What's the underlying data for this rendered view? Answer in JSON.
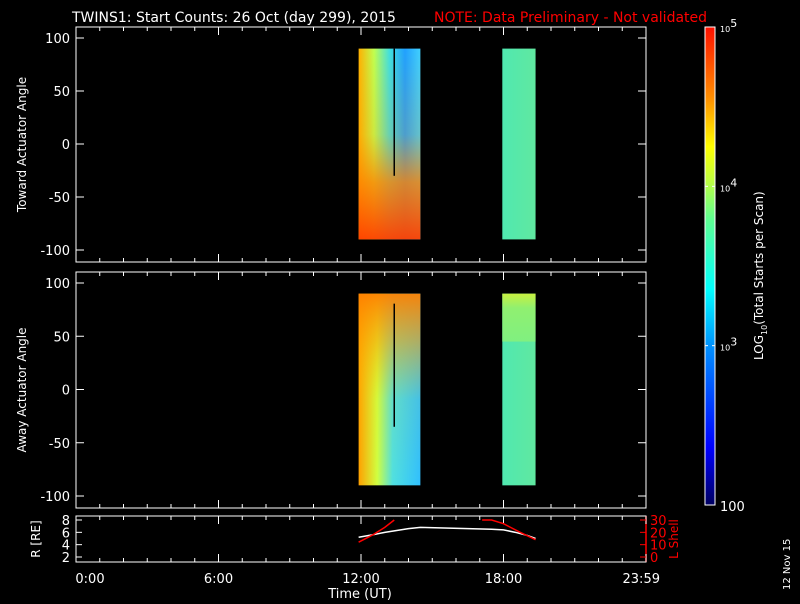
{
  "title": "TWINS1: Start Counts: 26 Oct (day 299), 2015",
  "note": "NOTE: Data Preliminary - Not validated",
  "date_stamp": "12 Nov 15",
  "colors": {
    "note": "#ff0000",
    "lshell": "#ff0000",
    "axis": "#ffffff"
  },
  "chart_data": [
    {
      "type": "heatmap",
      "ylabel": "Toward Actuator Angle",
      "ylim": [
        -100,
        100
      ],
      "yticks": [
        "100",
        "50",
        "0",
        "-50",
        "-100"
      ],
      "ytick_values": [
        100,
        50,
        0,
        -50,
        -100
      ],
      "xlim_hours": [
        0,
        24
      ],
      "data_blocks_hours": [
        [
          11.9,
          14.5
        ],
        [
          17.95,
          19.35
        ]
      ],
      "angle_range": [
        -90,
        90
      ]
    },
    {
      "type": "heatmap",
      "ylabel": "Away Actuator Angle",
      "ylim": [
        -100,
        100
      ],
      "yticks": [
        "100",
        "50",
        "0",
        "-50",
        "-100"
      ],
      "ytick_values": [
        100,
        50,
        0,
        -50,
        -100
      ],
      "xlim_hours": [
        0,
        24
      ],
      "data_blocks_hours": [
        [
          11.9,
          14.5
        ],
        [
          17.95,
          19.35
        ]
      ],
      "angle_range": [
        -90,
        90
      ]
    },
    {
      "type": "line",
      "ylabel": "R [RE]",
      "y2label": "L Shell",
      "ylim": [
        1.5,
        8
      ],
      "y2lim": [
        0,
        30
      ],
      "yticks": [
        "8",
        "6",
        "4",
        "2"
      ],
      "ytick_values": [
        8,
        6,
        4,
        2
      ],
      "y2ticks": [
        "30",
        "20",
        "10",
        "0"
      ],
      "y2tick_values": [
        30,
        20,
        10,
        0
      ],
      "xlabel": "Time (UT)",
      "xticks": [
        "0:00",
        "6:00",
        "12:00",
        "18:00",
        "23:59"
      ],
      "xtick_values": [
        0,
        6,
        12,
        18,
        23.98
      ],
      "series": [
        {
          "name": "R",
          "x": [
            11.9,
            12.5,
            13.0,
            13.5,
            14.0,
            14.5,
            15.5,
            16.5,
            17.5,
            18.0,
            18.5,
            19.0,
            19.35
          ],
          "y": [
            5.2,
            5.6,
            6.0,
            6.3,
            6.6,
            6.8,
            6.7,
            6.6,
            6.5,
            6.4,
            6.0,
            5.5,
            5.0
          ]
        },
        {
          "name": "L Shell",
          "axis": "y2",
          "segments": [
            {
              "x": [
                11.9,
                12.5,
                13.0,
                13.4
              ],
              "y": [
                12,
                18,
                24,
                30
              ]
            },
            {
              "x": [
                17.1,
                17.5,
                18.0,
                18.7,
                19.35
              ],
              "y": [
                30,
                30,
                27,
                20,
                14
              ]
            }
          ]
        }
      ]
    }
  ],
  "colorbar": {
    "label": "LOG10(Total Starts per Scan)",
    "label_main": "LOG",
    "label_sub": "10",
    "label_rest": "(Total Starts per Scan)",
    "range": [
      100,
      100000
    ],
    "ticks": [
      {
        "value": 100000,
        "base": "10",
        "exp": "5"
      },
      {
        "value": 10000,
        "base": "10",
        "exp": "4"
      },
      {
        "value": 1000,
        "base": "10",
        "exp": "3"
      },
      {
        "value": 100,
        "base": "100",
        "exp": ""
      }
    ]
  }
}
